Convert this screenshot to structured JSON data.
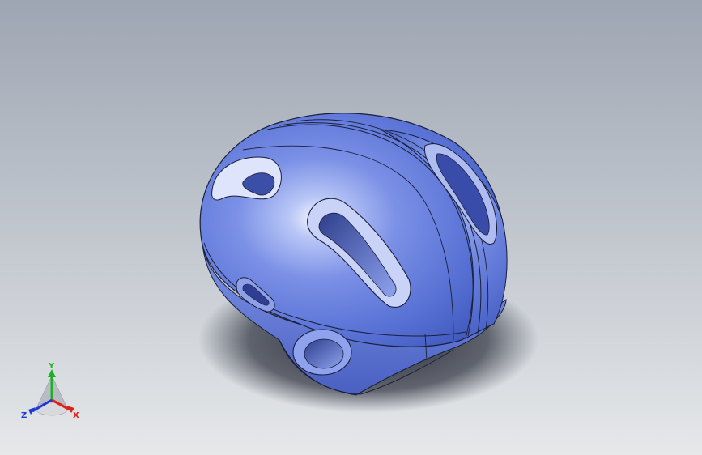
{
  "viewport": {
    "background_top": "#a0a8b4",
    "background_bottom": "#e4e6e9",
    "model_color": "#6f86e0",
    "model_shadow": "#2a2d3a"
  },
  "triad": {
    "x_label": "X",
    "y_label": "Y",
    "z_label": "Z",
    "x_color": "#e0201a",
    "y_color": "#1fb02a",
    "z_color": "#1a3ad8"
  }
}
